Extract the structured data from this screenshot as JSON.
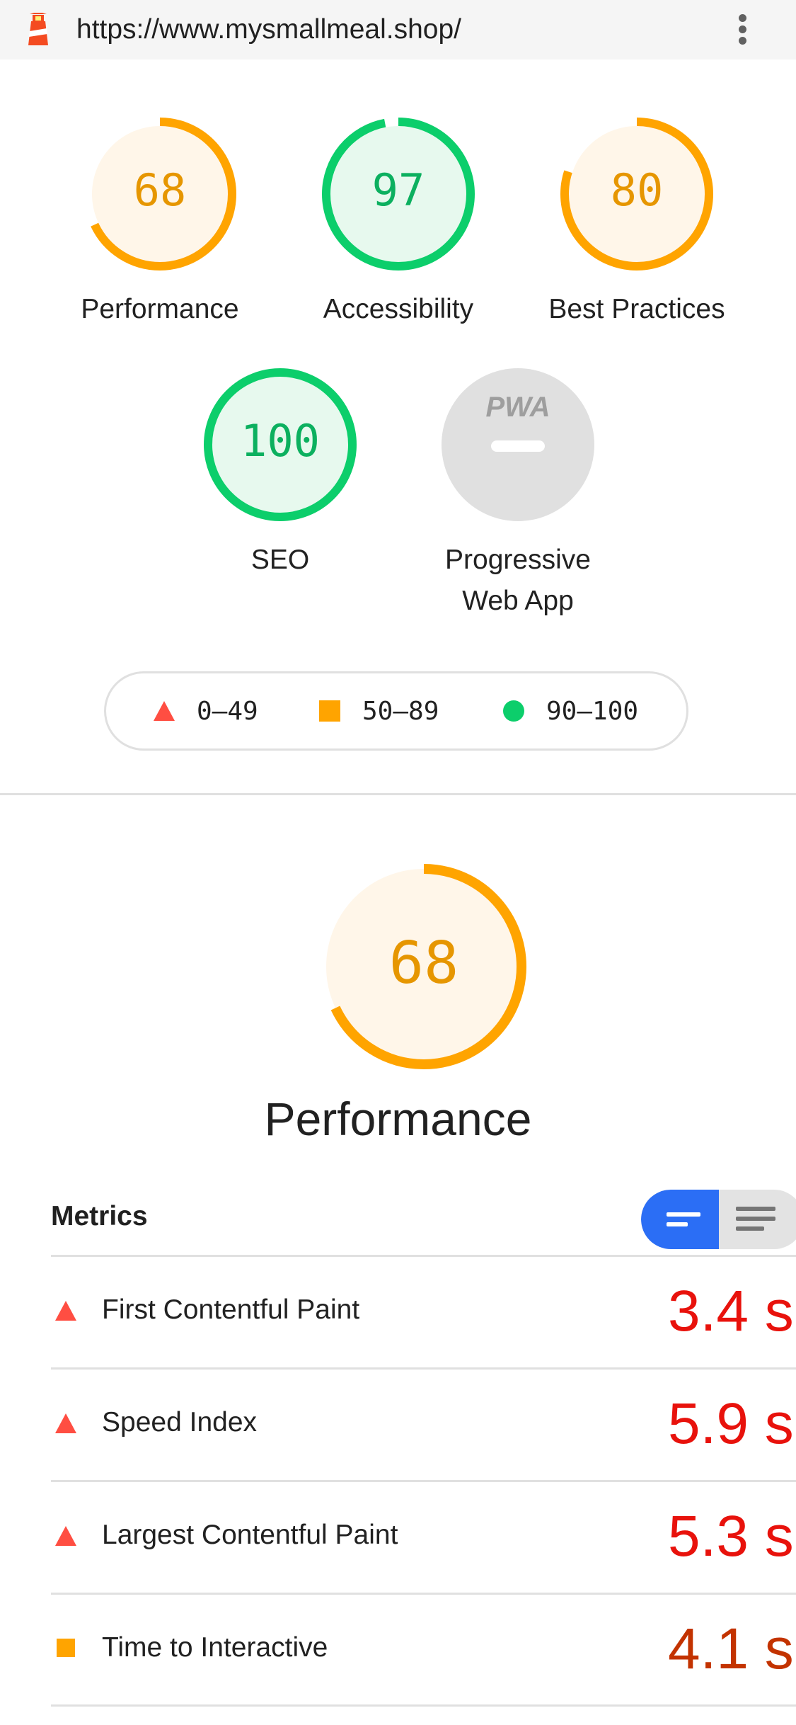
{
  "browser": {
    "url": "https://www.mysmallmeal.shop/"
  },
  "colors": {
    "fail": "#ff4e42",
    "fail_text": "#e8120c",
    "average": "#ffa400",
    "average_text": "#c33300",
    "pass": "#0cce6b",
    "pass_text": "#008800",
    "accent": "#2b6ef5"
  },
  "gauges": [
    {
      "key": "performance",
      "score": "68",
      "value": 68,
      "label": "Performance",
      "rating": "average"
    },
    {
      "key": "accessibility",
      "score": "97",
      "value": 97,
      "label": "Accessibility",
      "rating": "pass"
    },
    {
      "key": "best-practices",
      "score": "80",
      "value": 80,
      "label": "Best Practices",
      "rating": "average"
    },
    {
      "key": "seo",
      "score": "100",
      "value": 100,
      "label": "SEO",
      "rating": "pass"
    },
    {
      "key": "pwa",
      "badge": "PWA",
      "label_line1": "Progressive",
      "label_line2": "Web App",
      "rating": "na"
    }
  ],
  "legend": {
    "fail": "0–49",
    "average": "50–89",
    "pass": "90–100"
  },
  "performance": {
    "score": "68",
    "value": 68,
    "title": "Performance",
    "metrics_title": "Metrics",
    "metrics": [
      {
        "label": "First Contentful Paint",
        "value": "3.4 s",
        "rating": "fail",
        "icon": "triangle-icon"
      },
      {
        "label": "Speed Index",
        "value": "5.9 s",
        "rating": "fail",
        "icon": "triangle-icon"
      },
      {
        "label": "Largest Contentful Paint",
        "value": "5.3 s",
        "rating": "fail",
        "icon": "triangle-icon"
      },
      {
        "label": "Time to Interactive",
        "value": "4.1 s",
        "rating": "average",
        "icon": "square-icon"
      }
    ]
  }
}
